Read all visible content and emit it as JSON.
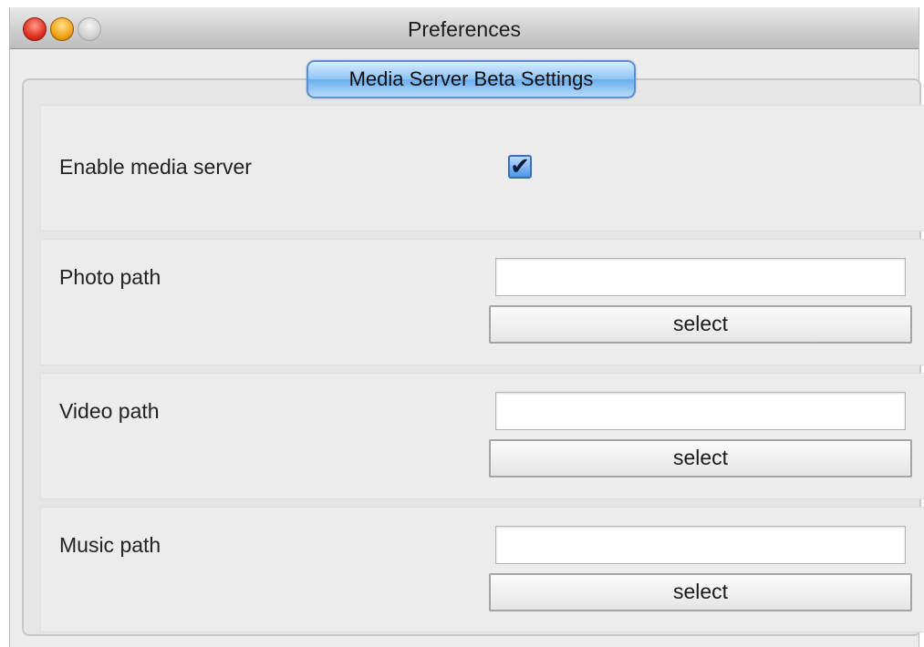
{
  "window": {
    "title": "Preferences"
  },
  "tab": {
    "label": "Media Server Beta Settings"
  },
  "settings": {
    "enable_media_server": {
      "label": "Enable media server",
      "checked": true,
      "check_glyph": "✔"
    },
    "photo_path": {
      "label": "Photo path",
      "value": "",
      "button_label": "select"
    },
    "video_path": {
      "label": "Video path",
      "value": "",
      "button_label": "select"
    },
    "music_path": {
      "label": "Music path",
      "value": "",
      "button_label": "select"
    }
  },
  "colors": {
    "tab_accent": "#6aaeec",
    "checkbox_accent": "#4e95e6"
  }
}
